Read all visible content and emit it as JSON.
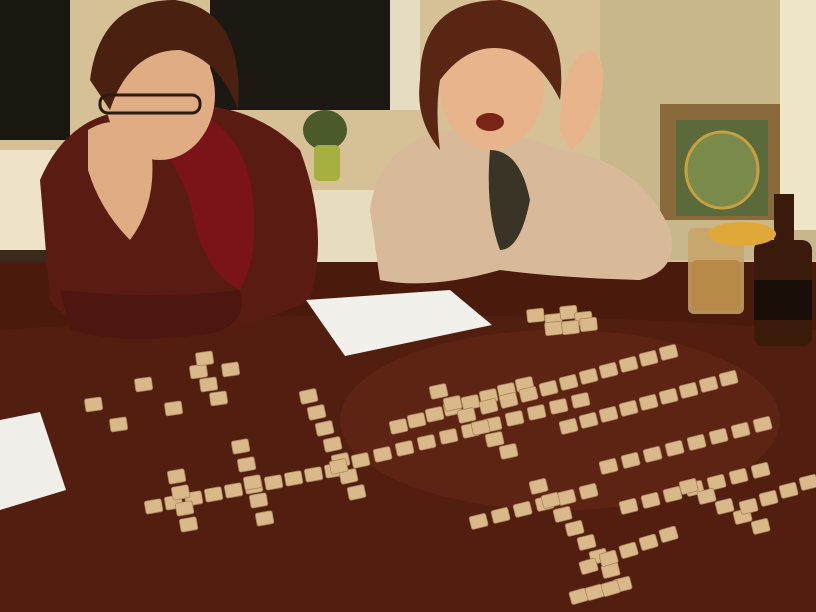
{
  "scene": {
    "description_tag": "photo",
    "colors": {
      "wall": "#d9c69a",
      "window": "#1e1a12",
      "cabinet": "#e8dcc0",
      "table": "#4a1a0c",
      "table_highlight": "#6a2a16",
      "tile": "#d9b98a",
      "tile_edge": "#a8845a",
      "sweater_left": "#5a1c12",
      "scarf": "#7a1418",
      "cardigan_right": "#d8b99a",
      "skin": "#e8b48c",
      "hair_left": "#4a2010",
      "hair_right": "#5a2614",
      "paper": "#f2f0ea",
      "bottle": "#3a1a0a",
      "glass": "#c8a468"
    }
  }
}
